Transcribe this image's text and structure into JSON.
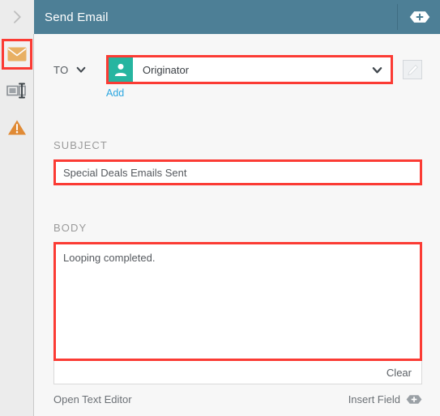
{
  "header": {
    "title": "Send Email",
    "collapse_icon": "chevron-right-icon",
    "add_step_icon": "plus-hex-icon"
  },
  "sidebar": {
    "items": [
      {
        "icon": "envelope-icon",
        "name": "email-step",
        "selected": true
      },
      {
        "icon": "text-field-icon",
        "name": "text-field-step",
        "selected": false
      },
      {
        "icon": "warning-triangle-icon",
        "name": "warning-step",
        "selected": false
      }
    ]
  },
  "form": {
    "to": {
      "label": "TO",
      "caret_icon": "chevron-down-icon",
      "recipient": "Originator",
      "recipient_avatar_icon": "person-icon",
      "recipient_caret_icon": "chevron-down-icon",
      "edit_icon": "pencil-icon",
      "add_label": "Add"
    },
    "subject": {
      "label": "SUBJECT",
      "value": "Special Deals Emails Sent",
      "placeholder": ""
    },
    "body": {
      "label": "BODY",
      "value": "Looping completed.",
      "placeholder": "",
      "clear_label": "Clear"
    }
  },
  "footer": {
    "open_text_editor_label": "Open Text Editor",
    "insert_field_label": "Insert Field",
    "insert_field_icon": "plus-hex-icon"
  },
  "colors": {
    "header_bg": "#4d7f96",
    "rail_bg": "#ececec",
    "content_bg": "#f7f7f7",
    "highlight": "#fb3b34",
    "avatar_bg": "#26b5a0",
    "link": "#2ba6e0",
    "warning": "#e08a35",
    "envelope": "#e8b063"
  }
}
